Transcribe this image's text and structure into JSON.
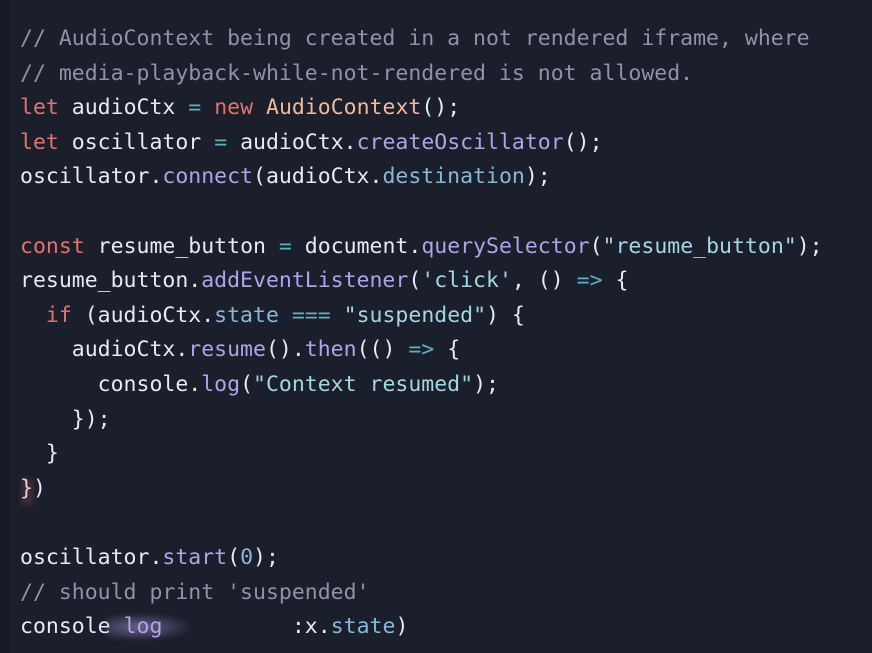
{
  "editor": {
    "language": "javascript",
    "theme_name": "dark-navy",
    "background_color": "#1b1e2b",
    "gutter_color": "#181b26",
    "colors": {
      "comment": "#8e93a6",
      "keyword": "#e3726f",
      "plain_text": "#e8eaf2",
      "type": "#f0b99a",
      "function": "#b0a3e8",
      "property": "#87b8d8",
      "string": "#a5d6e4",
      "operator": "#5bb3c4",
      "number": "#87b8d8"
    }
  },
  "code": {
    "lines": [
      {
        "index": 1,
        "text": "// AudioContext being created in a not rendered iframe, where",
        "tokens": [
          {
            "t": "// AudioContext being created in a not rendered iframe, where",
            "c": "comment"
          }
        ]
      },
      {
        "index": 2,
        "text": "// media-playback-while-not-rendered is not allowed.",
        "tokens": [
          {
            "t": "// media-playback-while-not-rendered is not allowed.",
            "c": "comment"
          }
        ]
      },
      {
        "index": 3,
        "text": "let audioCtx = new AudioContext();",
        "tokens": [
          {
            "t": "let",
            "c": "keyword"
          },
          {
            "t": " audioCtx ",
            "c": "plain"
          },
          {
            "t": "=",
            "c": "operator"
          },
          {
            "t": " ",
            "c": "plain"
          },
          {
            "t": "new",
            "c": "keyword"
          },
          {
            "t": " ",
            "c": "plain"
          },
          {
            "t": "AudioContext",
            "c": "type"
          },
          {
            "t": "();",
            "c": "punct"
          }
        ]
      },
      {
        "index": 4,
        "text": "let oscillator = audioCtx.createOscillator();",
        "tokens": [
          {
            "t": "let",
            "c": "keyword"
          },
          {
            "t": " oscillator ",
            "c": "plain"
          },
          {
            "t": "=",
            "c": "operator"
          },
          {
            "t": " audioCtx.",
            "c": "plain"
          },
          {
            "t": "createOscillator",
            "c": "func"
          },
          {
            "t": "();",
            "c": "punct"
          }
        ]
      },
      {
        "index": 5,
        "text": "oscillator.connect(audioCtx.destination);",
        "tokens": [
          {
            "t": "oscillator.",
            "c": "plain"
          },
          {
            "t": "connect",
            "c": "func"
          },
          {
            "t": "(audioCtx.",
            "c": "plain"
          },
          {
            "t": "destination",
            "c": "prop"
          },
          {
            "t": ");",
            "c": "punct"
          }
        ]
      },
      {
        "index": 6,
        "text": "",
        "tokens": []
      },
      {
        "index": 7,
        "text": "const resume_button = document.querySelector(\"resume_button\");",
        "tokens": [
          {
            "t": "const",
            "c": "keyword"
          },
          {
            "t": " resume_button ",
            "c": "plain"
          },
          {
            "t": "=",
            "c": "operator"
          },
          {
            "t": " document.",
            "c": "plain"
          },
          {
            "t": "querySelector",
            "c": "func"
          },
          {
            "t": "(",
            "c": "punct"
          },
          {
            "t": "\"resume_button\"",
            "c": "string"
          },
          {
            "t": ");",
            "c": "punct"
          }
        ]
      },
      {
        "index": 8,
        "text": "resume_button.addEventListener('click', () => {",
        "tokens": [
          {
            "t": "resume_button.",
            "c": "plain"
          },
          {
            "t": "addEventListener",
            "c": "func"
          },
          {
            "t": "(",
            "c": "punct"
          },
          {
            "t": "'click'",
            "c": "string"
          },
          {
            "t": ", () ",
            "c": "punct"
          },
          {
            "t": "=>",
            "c": "operator"
          },
          {
            "t": " {",
            "c": "punct"
          }
        ]
      },
      {
        "index": 9,
        "text": "  if (audioCtx.state === \"suspended\") {",
        "tokens": [
          {
            "t": "  ",
            "c": "plain"
          },
          {
            "t": "if",
            "c": "keyword"
          },
          {
            "t": " (audioCtx.",
            "c": "plain"
          },
          {
            "t": "state",
            "c": "prop"
          },
          {
            "t": " ",
            "c": "plain"
          },
          {
            "t": "===",
            "c": "operator"
          },
          {
            "t": " ",
            "c": "plain"
          },
          {
            "t": "\"suspended\"",
            "c": "string"
          },
          {
            "t": ") {",
            "c": "punct"
          }
        ]
      },
      {
        "index": 10,
        "text": "    audioCtx.resume().then(() => {",
        "tokens": [
          {
            "t": "    audioCtx.",
            "c": "plain"
          },
          {
            "t": "resume",
            "c": "func"
          },
          {
            "t": "().",
            "c": "punct"
          },
          {
            "t": "then",
            "c": "func"
          },
          {
            "t": "(() ",
            "c": "punct"
          },
          {
            "t": "=>",
            "c": "operator"
          },
          {
            "t": " {",
            "c": "punct"
          }
        ]
      },
      {
        "index": 11,
        "text": "      console.log(\"Context resumed\");",
        "tokens": [
          {
            "t": "      console.",
            "c": "plain"
          },
          {
            "t": "log",
            "c": "func"
          },
          {
            "t": "(",
            "c": "punct"
          },
          {
            "t": "\"Context resumed\"",
            "c": "string"
          },
          {
            "t": ");",
            "c": "punct"
          }
        ]
      },
      {
        "index": 12,
        "text": "    });",
        "tokens": [
          {
            "t": "    });",
            "c": "punct"
          }
        ]
      },
      {
        "index": 13,
        "text": "  }",
        "tokens": [
          {
            "t": "  }",
            "c": "punct"
          }
        ]
      },
      {
        "index": 14,
        "text": "})",
        "tokens": [
          {
            "t": "})",
            "c": "punct"
          }
        ]
      },
      {
        "index": 15,
        "text": "",
        "tokens": []
      },
      {
        "index": 16,
        "text": "oscillator.start(0);",
        "tokens": [
          {
            "t": "oscillator.",
            "c": "plain"
          },
          {
            "t": "start",
            "c": "func"
          },
          {
            "t": "(",
            "c": "punct"
          },
          {
            "t": "0",
            "c": "number"
          },
          {
            "t": ");",
            "c": "punct"
          }
        ]
      },
      {
        "index": 17,
        "text": "// should print 'suspended'",
        "tokens": [
          {
            "t": "// should print 'suspended'",
            "c": "comment"
          }
        ]
      },
      {
        "index": 18,
        "text": "console log          :x.state)",
        "tokens": [
          {
            "t": "console ",
            "c": "plain"
          },
          {
            "t": "log",
            "c": "func"
          },
          {
            "t": "          ",
            "c": "plain"
          },
          {
            "t": ":x.",
            "c": "plain"
          },
          {
            "t": "state",
            "c": "prop"
          },
          {
            "t": ")",
            "c": "punct"
          }
        ]
      }
    ]
  }
}
